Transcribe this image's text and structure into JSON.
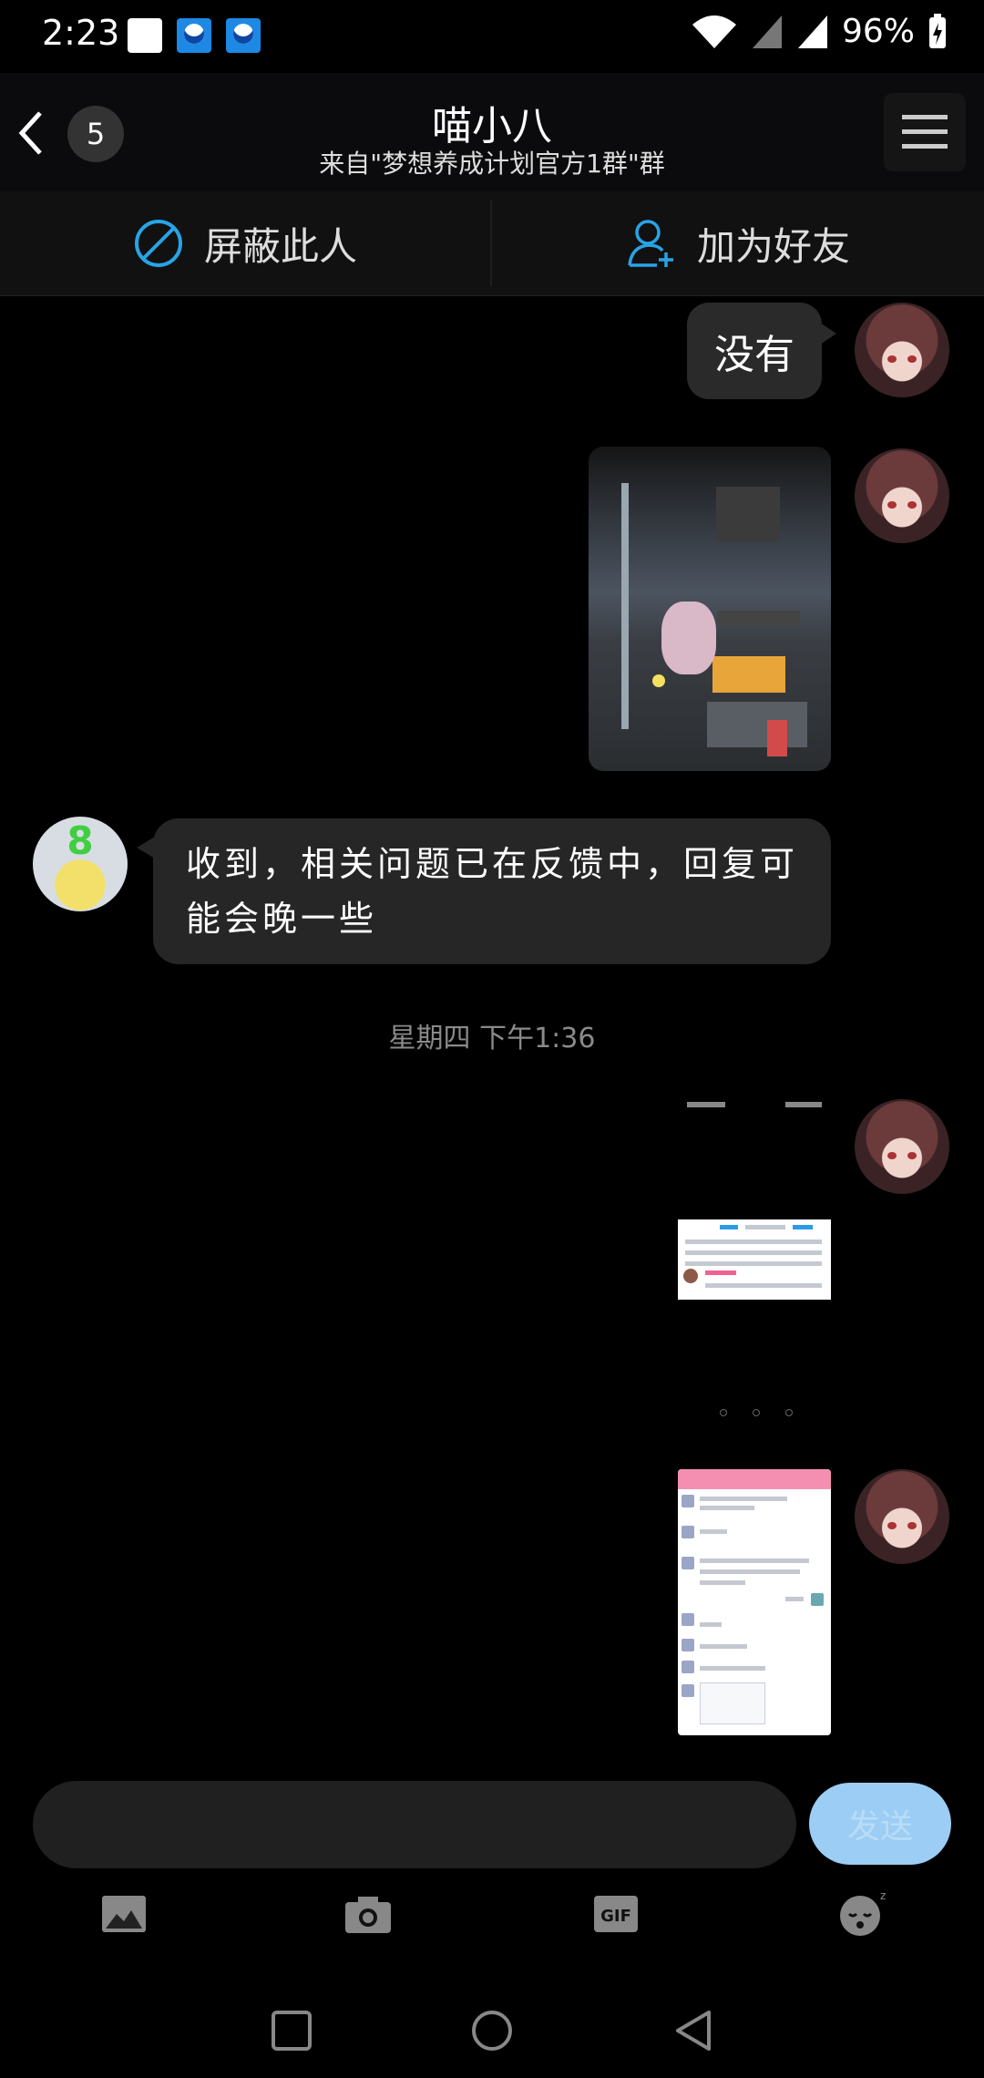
{
  "status_bar": {
    "time": "2:23",
    "battery": "96%"
  },
  "header": {
    "unread_count": "5",
    "title": "喵小八",
    "subtitle": "来自\"梦想养成计划官方1群\"群"
  },
  "actions": {
    "block_label": "屏蔽此人",
    "add_friend_label": "加为好友"
  },
  "messages": {
    "m1_text": "没有",
    "m3_text": "收到，相关问题已在反馈中，回复可能会晚一些",
    "time_separator": "星期四 下午1:36"
  },
  "composer": {
    "send_label": "发送"
  },
  "colors": {
    "accent": "#1e88e5",
    "send_disabled": "#9ccdf4",
    "bubble": "#2a2a2a"
  }
}
